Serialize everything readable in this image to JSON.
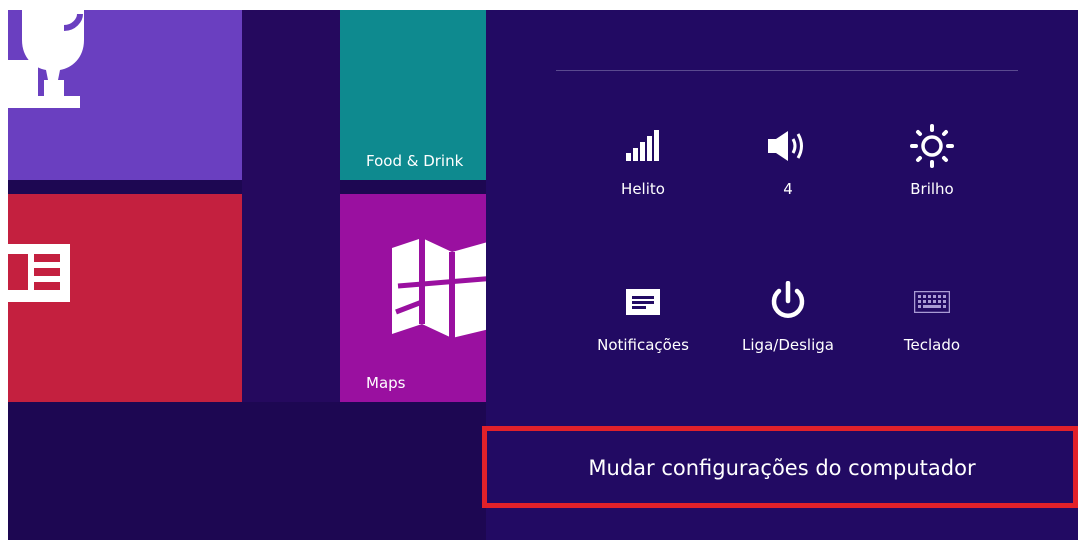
{
  "tiles": {
    "food": {
      "label": "Food & Drink"
    },
    "maps": {
      "label": "Maps"
    }
  },
  "quick_settings": {
    "network": {
      "label": "Helito",
      "icon": "signal-bars-icon"
    },
    "volume": {
      "label": "4",
      "icon": "speaker-icon"
    },
    "brightness": {
      "label": "Brilho",
      "icon": "sun-icon"
    },
    "notifications": {
      "label": "Notificações",
      "icon": "notifications-icon"
    },
    "power": {
      "label": "Liga/Desliga",
      "icon": "power-icon"
    },
    "keyboard": {
      "label": "Teclado",
      "icon": "keyboard-icon"
    }
  },
  "settings_link": {
    "label": "Mudar configurações do computador"
  },
  "colors": {
    "background": "#1d0752",
    "panel": "#220a63",
    "highlight": "#e2212a",
    "tile_games": "#6a3fc0",
    "tile_news": "#c4203f",
    "tile_food": "#0e8a8f",
    "tile_maps": "#9a10a0"
  }
}
